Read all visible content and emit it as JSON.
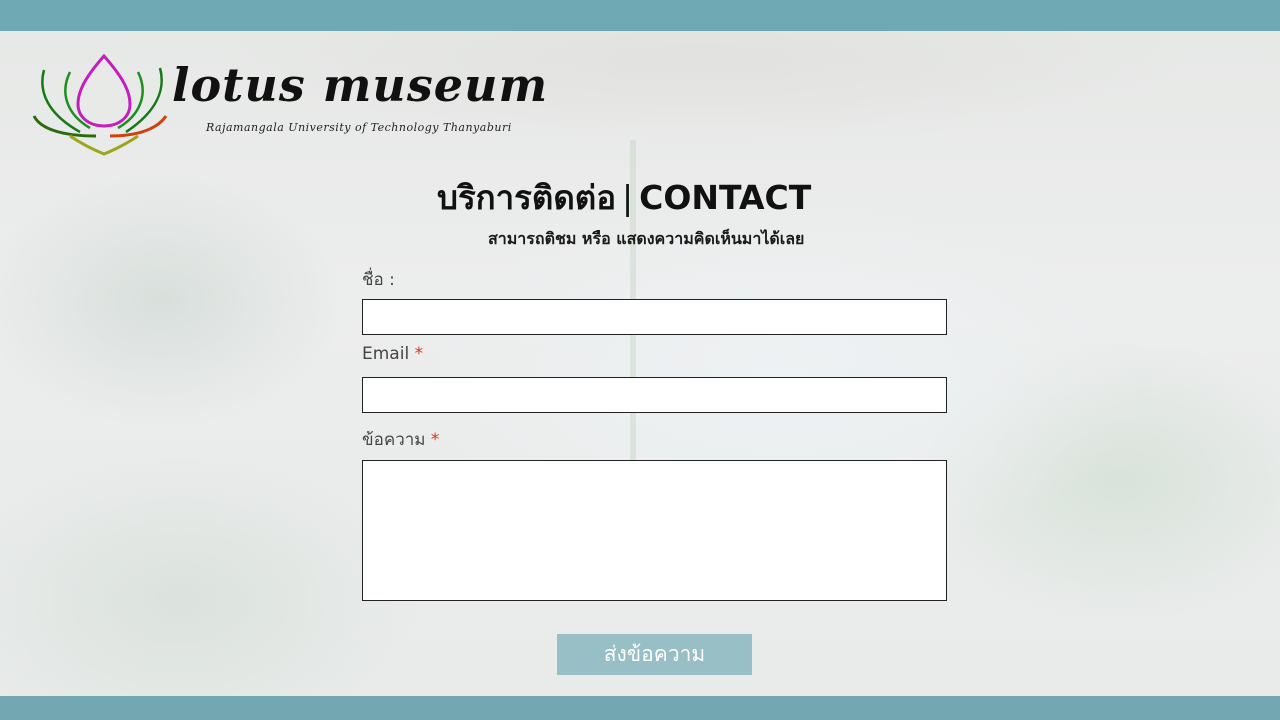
{
  "logo": {
    "title": "lotus museum",
    "subtitle": "Rajamangala University of Technology Thanyaburi"
  },
  "header": {
    "title_th": "บริการติดต่อ",
    "separator": "|",
    "title_en": "CONTACT",
    "subtitle": "สามารถติชม หรือ แสดงความคิดเห็นมาได้เลย"
  },
  "form": {
    "name_label": "ชื่อ :",
    "name_value": "",
    "email_label": "Email",
    "email_value": "",
    "message_label": "ข้อความ",
    "message_value": "",
    "required_mark": "*",
    "submit_label": "ส่งข้อความ"
  },
  "colors": {
    "top_bar": "#6ea9b4",
    "bottom_bar": "#73a8b2",
    "submit_button": "#97bfc5",
    "required": "#e0321e"
  }
}
